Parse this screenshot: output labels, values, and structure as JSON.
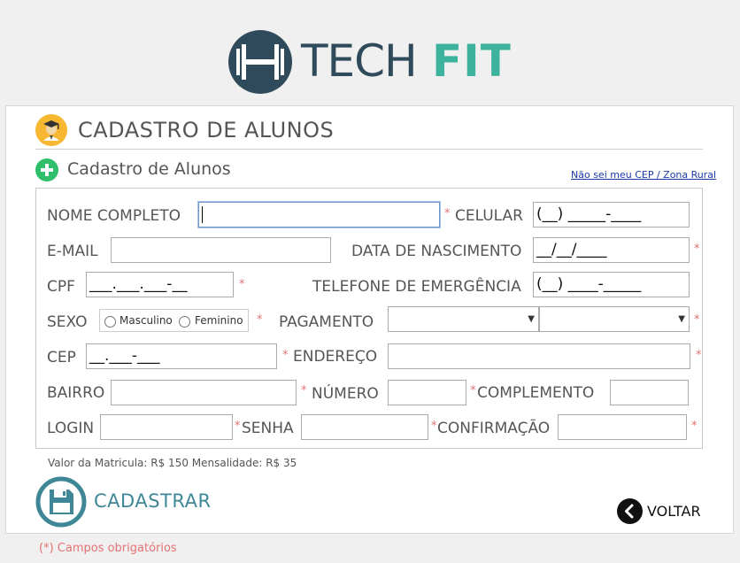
{
  "brand": {
    "tech": "TECH",
    "fit": "FIT"
  },
  "page_title": "CADASTRO DE ALUNOS",
  "section_title": "Cadastro de Alunos",
  "cep_link": "Não sei meu CEP / Zona Rural",
  "fields": {
    "nome": {
      "label": "NOME COMPLETO",
      "value": ""
    },
    "celular": {
      "label": "CELULAR",
      "value": "(__) _____-____"
    },
    "email": {
      "label": "E-MAIL",
      "value": ""
    },
    "nascimento": {
      "label": "DATA DE NASCIMENTO",
      "value": "__/__/____"
    },
    "cpf": {
      "label": "CPF",
      "value": "___.___.___-__"
    },
    "emergencia": {
      "label": "TELEFONE DE EMERGÊNCIA",
      "value": "(__) ____-_____"
    },
    "sexo": {
      "label": "SEXO",
      "options": [
        "Masculino",
        "Feminino"
      ]
    },
    "pagamento": {
      "label": "PAGAMENTO",
      "value1": "",
      "value2": ""
    },
    "cep": {
      "label": "CEP",
      "value": "__.___-___"
    },
    "endereco": {
      "label": "ENDEREÇO",
      "value": ""
    },
    "bairro": {
      "label": "BAIRRO",
      "value": ""
    },
    "numero": {
      "label": "NÚMERO",
      "value": ""
    },
    "complemento": {
      "label": "COMPLEMENTO",
      "value": ""
    },
    "login": {
      "label": "LOGIN",
      "value": ""
    },
    "senha": {
      "label": "SENHA",
      "value": ""
    },
    "confirmacao": {
      "label": "CONFIRMAÇÃO",
      "value": ""
    }
  },
  "required_mark": "*",
  "valor_text": "Valor da Matricula: R$ 150 Mensalidade: R$ 35",
  "submit_label": "CADASTRAR",
  "back_label": "VOLTAR",
  "required_note": "(*) Campos obrigatórios",
  "colors": {
    "dark": "#2f4a5a",
    "teal": "#3db39e",
    "cadastrar": "#3f8797",
    "required": "#e57373",
    "link": "#1a3aa8",
    "icon_yellow": "#f7b731",
    "icon_green": "#2fbf6a"
  },
  "icons": [
    "student-icon",
    "plus-circle-icon",
    "save-icon",
    "back-arrow-icon",
    "chevron-down-icon"
  ]
}
